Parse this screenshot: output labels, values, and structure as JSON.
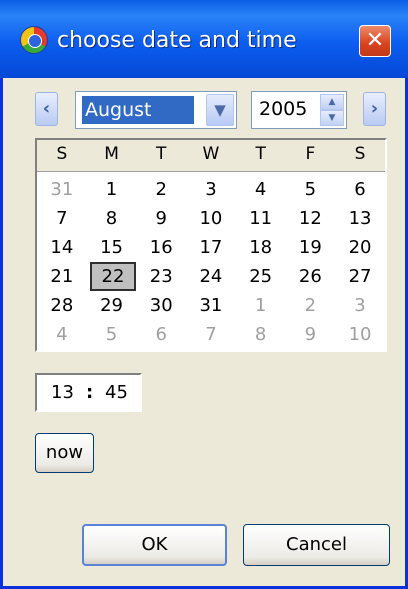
{
  "window": {
    "title": "choose date and time",
    "close_glyph": "✕"
  },
  "navigation": {
    "prev_glyph": "‹",
    "next_glyph": "›"
  },
  "month_select": {
    "value": "August",
    "arrow": "▼"
  },
  "year_spinner": {
    "value": "2005",
    "up": "▲",
    "down": "▼"
  },
  "calendar": {
    "weekdays": [
      "S",
      "M",
      "T",
      "W",
      "T",
      "F",
      "S"
    ],
    "weeks": [
      [
        "31",
        "1",
        "2",
        "3",
        "4",
        "5",
        "6"
      ],
      [
        "7",
        "8",
        "9",
        "10",
        "11",
        "12",
        "13"
      ],
      [
        "14",
        "15",
        "16",
        "17",
        "18",
        "19",
        "20"
      ],
      [
        "21",
        "22",
        "23",
        "24",
        "25",
        "26",
        "27"
      ],
      [
        "28",
        "29",
        "30",
        "31",
        "1",
        "2",
        "3"
      ],
      [
        "4",
        "5",
        "6",
        "7",
        "8",
        "9",
        "10"
      ]
    ],
    "selected_day": "22"
  },
  "time": {
    "hour": "13",
    "separator": ":",
    "minute": "45"
  },
  "buttons": {
    "now": "now",
    "ok": "OK",
    "cancel": "Cancel"
  }
}
